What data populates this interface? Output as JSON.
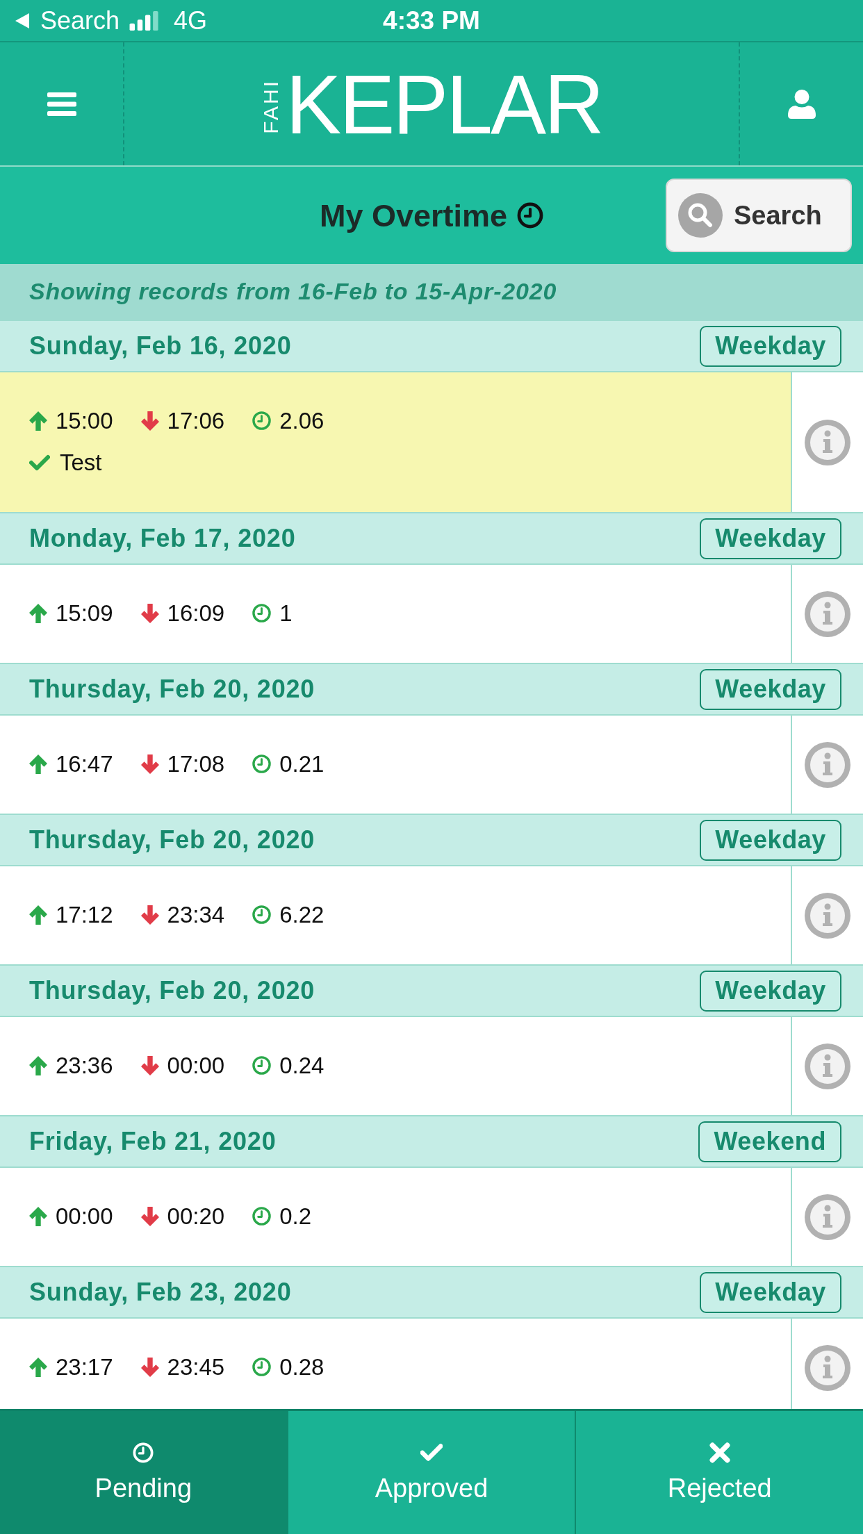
{
  "status_bar": {
    "back_label": "Search",
    "network": "4G",
    "time": "4:33 PM"
  },
  "header": {
    "logo_prefix": "FAHI",
    "logo_name": "KEPLAR"
  },
  "title_bar": {
    "title": "My Overtime",
    "search_button": "Search"
  },
  "range_notice": "Showing records from 16-Feb to 15-Apr-2020",
  "records": [
    {
      "date": "Sunday, Feb 16, 2020",
      "day_type": "Weekday",
      "highlighted": true,
      "time_in": "15:00",
      "time_out": "17:06",
      "hours": "2.06",
      "note": "Test"
    },
    {
      "date": "Monday, Feb 17, 2020",
      "day_type": "Weekday",
      "highlighted": false,
      "time_in": "15:09",
      "time_out": "16:09",
      "hours": "1"
    },
    {
      "date": "Thursday, Feb 20, 2020",
      "day_type": "Weekday",
      "highlighted": false,
      "time_in": "16:47",
      "time_out": "17:08",
      "hours": "0.21"
    },
    {
      "date": "Thursday, Feb 20, 2020",
      "day_type": "Weekday",
      "highlighted": false,
      "time_in": "17:12",
      "time_out": "23:34",
      "hours": "6.22"
    },
    {
      "date": "Thursday, Feb 20, 2020",
      "day_type": "Weekday",
      "highlighted": false,
      "time_in": "23:36",
      "time_out": "00:00",
      "hours": "0.24"
    },
    {
      "date": "Friday, Feb 21, 2020",
      "day_type": "Weekend",
      "highlighted": false,
      "time_in": "00:00",
      "time_out": "00:20",
      "hours": "0.2"
    },
    {
      "date": "Sunday, Feb 23, 2020",
      "day_type": "Weekday",
      "highlighted": false,
      "time_in": "23:17",
      "time_out": "23:45",
      "hours": "0.28"
    }
  ],
  "tabs": [
    {
      "kind": "pending",
      "label": "Pending",
      "selected": true
    },
    {
      "kind": "approved",
      "label": "Approved",
      "selected": false
    },
    {
      "kind": "rejected",
      "label": "Rejected",
      "selected": false
    }
  ]
}
